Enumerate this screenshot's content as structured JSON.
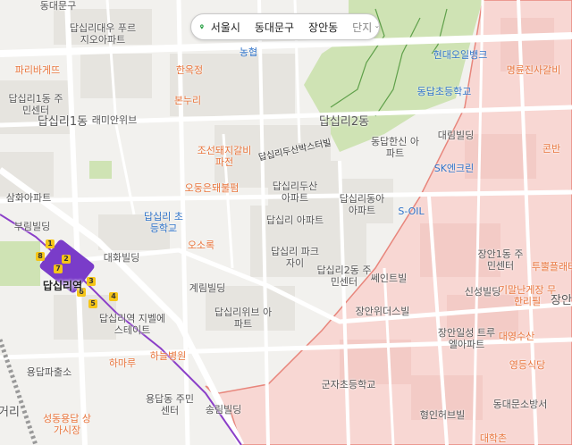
{
  "breadcrumb": {
    "city": "서울시",
    "district": "동대문구",
    "dong": "장안동",
    "mode": "단지"
  },
  "colors": {
    "background": "#f2f1ee",
    "highlight_area": "#f8d7d3",
    "highlight_border": "#e8867c",
    "park": "#cfe3b4",
    "subway_line": "#8b3fc8",
    "station": "#7a3cc9",
    "exit_badge": "#f5c518",
    "location_pin": "#2aa146"
  },
  "labels": {
    "area": [
      {
        "id": "dapsimni-1dong",
        "text": "답십리1동"
      },
      {
        "id": "dapsimni-2dong",
        "text": "답십리2동"
      },
      {
        "id": "jangan",
        "text": "장안"
      },
      {
        "id": "geori",
        "text": "거리"
      }
    ],
    "station": {
      "text": "답십리역"
    },
    "road": {
      "text": "답십리두산박스터빌"
    },
    "food": [
      {
        "id": "paris",
        "text": "파리바게뜨"
      },
      {
        "id": "hanokjeong",
        "text": "한옥정"
      },
      {
        "id": "bonsuri",
        "text": "본누리"
      },
      {
        "id": "joseon-galbi",
        "text": "조선돼지갈비 파전"
      },
      {
        "id": "odungjeon",
        "text": "오둥은돼불펌"
      },
      {
        "id": "osorok",
        "text": "오소록"
      },
      {
        "id": "hamaru",
        "text": "하마루"
      },
      {
        "id": "myeongdong",
        "text": "명륜진사갈비"
      },
      {
        "id": "kongban",
        "text": "콘반"
      },
      {
        "id": "tuppeul",
        "text": "투뿔플래터"
      },
      {
        "id": "kimalnaegejang",
        "text": "기말난게장 무한리필"
      },
      {
        "id": "daeyang",
        "text": "대영수산"
      },
      {
        "id": "yeongdeung",
        "text": "영등식당"
      },
      {
        "id": "daehakchon",
        "text": "대학촌"
      }
    ],
    "place": [
      {
        "id": "dapsimni-daewoo",
        "text": "답십리대우 푸르지오아파트"
      },
      {
        "id": "dapsimni1-center",
        "text": "답십리1동 주민센터"
      },
      {
        "id": "raemian-view",
        "text": "래미안위브"
      },
      {
        "id": "samhwa",
        "text": "삼화아파트"
      },
      {
        "id": "burim",
        "text": "부림빌딩"
      },
      {
        "id": "daehwa",
        "text": "대화빌딩"
      },
      {
        "id": "gyerim",
        "text": "계림빌딩"
      },
      {
        "id": "dapsimni-elementary",
        "text": "답십리 초등학교"
      },
      {
        "id": "jipeulleoseu",
        "text": "답십리역 지벨에스테이트"
      },
      {
        "id": "yongdap-police",
        "text": "용답파출소"
      },
      {
        "id": "seongdong-market",
        "text": "성동용답 상가시장"
      },
      {
        "id": "yongdap-center",
        "text": "용답동 주민센터"
      },
      {
        "id": "hana-hospital",
        "text": "하늘병원"
      },
      {
        "id": "songjeon",
        "text": "송림빌딩"
      },
      {
        "id": "dapsimni-park-xi",
        "text": "답십리 파크자이"
      },
      {
        "id": "dapsimni-duson",
        "text": "답십리두산 아파트"
      },
      {
        "id": "dapsimni-dongah",
        "text": "답십리동아 아파트"
      },
      {
        "id": "dapsimni-hansin",
        "text": "답십리 아파트"
      },
      {
        "id": "dongdap-hansin",
        "text": "동답한신 아파트"
      },
      {
        "id": "dapsimni2-center",
        "text": "답십리2동 주민센터"
      },
      {
        "id": "dapsimni-wibu",
        "text": "답십리위브 아파트"
      },
      {
        "id": "dapsimni-tebeul",
        "text": "쎄인트빌"
      },
      {
        "id": "janganwiseu",
        "text": "장안위더스빌"
      },
      {
        "id": "sinseong",
        "text": "신성빌딩"
      },
      {
        "id": "jangan1dong",
        "text": "장안1동 주민센터"
      },
      {
        "id": "janganilseong",
        "text": "장안일성 트루엘아파트"
      },
      {
        "id": "gunja-elementary",
        "text": "군자초등학교"
      },
      {
        "id": "hyeongin",
        "text": "형인허브빌"
      },
      {
        "id": "dongdaemun-fire",
        "text": "동대문소방서"
      },
      {
        "id": "nonghyup",
        "text": "농협"
      },
      {
        "id": "hyundai-oil",
        "text": "현대오일뱅크"
      },
      {
        "id": "dongdap-elementary",
        "text": "동답초등학교"
      },
      {
        "id": "daerim-building",
        "text": "대림빌딩"
      },
      {
        "id": "sk-enclean",
        "text": "SK엔크린"
      },
      {
        "id": "s-oil",
        "text": "S-OIL"
      },
      {
        "id": "dongdaemun-top",
        "text": "동대문구"
      }
    ]
  },
  "station_exits": [
    "1",
    "2",
    "3",
    "4",
    "5",
    "6",
    "7",
    "8"
  ]
}
